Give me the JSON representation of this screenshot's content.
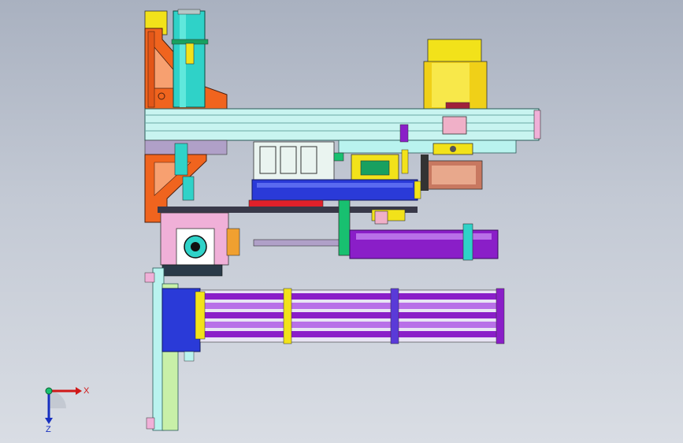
{
  "viewport": {
    "title": "",
    "background_top": "#a9b1c0",
    "background_bottom": "#d9dde4"
  },
  "model": {
    "components": [
      "vertical-orange-bracket-frame",
      "green-vertical-cylinder",
      "yellow-servo-motor",
      "horizontal-aluminum-beam",
      "linear-rail-slider",
      "blue-carriage-block",
      "belt-pulley",
      "gripper-head",
      "purple-pneumatic-cylinder",
      "purple-rod-bundle",
      "vertical-green-column"
    ],
    "colors": {
      "orange": "#f0641e",
      "cyan": "#2fd2c8",
      "yellow": "#f2e21a",
      "blue": "#2a3ad8",
      "purple": "#8a1ec8",
      "green": "#18c070",
      "lightcyan": "#b9f3ef",
      "pink": "#f0b0d8",
      "red": "#e0202a"
    }
  },
  "triad": {
    "x_label": "X",
    "z_label": "Z",
    "x_color": "#d01818",
    "z_color": "#1830c0"
  }
}
